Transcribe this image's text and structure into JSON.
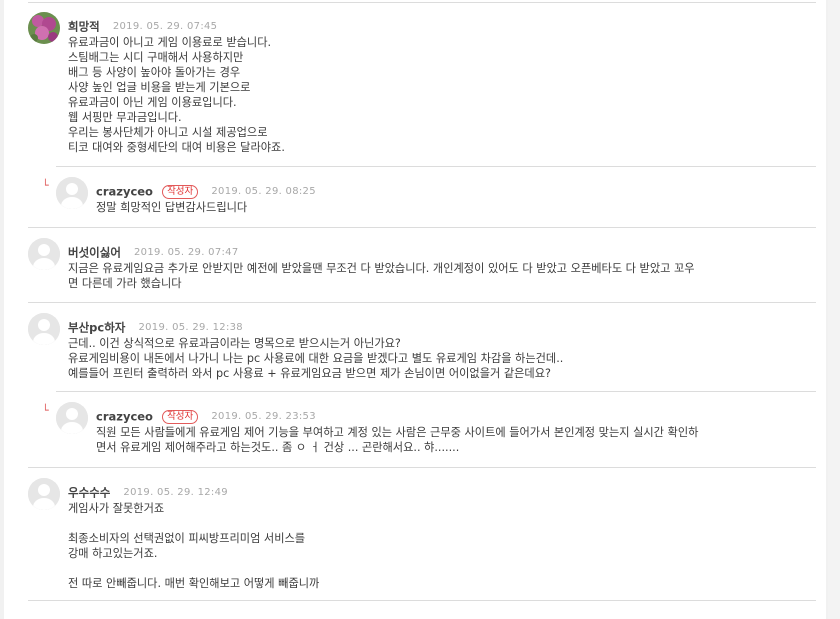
{
  "comments": [
    {
      "author": "희망적",
      "date": "2019. 05. 29.  07:45",
      "lines": [
        "유료과금이 아니고 게임 이용료로 받습니다.",
        "스팀배그는 시디 구매해서 사용하지만",
        "배그 등 사양이 높아야 돌아가는 경우",
        "사양 높인 업글 비용을 받는게 기본으로",
        "유료과금이 아닌 게임 이용료입니다.",
        "웹 서핑만 무과금입니다.",
        "우리는 봉사단체가 아니고 시설 제공업으로",
        "티코 대여와 중형세단의 대여 비용은 달라야죠."
      ]
    },
    {
      "author": "crazyceo",
      "badge": "작성자",
      "date": "2019. 05. 29.  08:25",
      "lines": [
        "정말 희망적인 답변감사드립니다"
      ]
    },
    {
      "author": "버섯이싫어",
      "date": "2019. 05. 29.  07:47",
      "lines": [
        "지금은 유료게임요금 추가로 안받지만 예전에 받았을땐 무조건 다 받았습니다. 개인계정이 있어도 다 받았고 오픈베타도 다 받았고 꼬우",
        "면 다른데 가라 했습니다"
      ]
    },
    {
      "author": "부산pc하자",
      "date": "2019. 05. 29.  12:38",
      "lines": [
        "근데.. 이건 상식적으로 유료과금이라는 명목으로 받으시는거 아닌가요?",
        "유료게임비용이 내돈에서 나가니 나는 pc 사용료에 대한 요금을 받겠다고 별도 유료게임 차감을 하는건데..",
        "예를들어 프린터 출력하러 와서 pc 사용료 + 유료게임요금 받으면 제가 손님이면 어이없을거 같은데요?"
      ]
    },
    {
      "author": "crazyceo",
      "badge": "작성자",
      "date": "2019. 05. 29.  23:53",
      "lines": [
        "직원 모든 사람들에게 유료게임 제어 기능을 부여하고 계정 있는 사람은 근무중 사이트에 들어가서 본인계정 맞는지 실시간 확인하",
        "면서 유료게임 제어해주라고 하는것도.. 좀 ㅇ ㅓ 건상 ... 곤란해서요.. 햐......."
      ]
    },
    {
      "author": "우수수수",
      "date": "2019. 05. 29.  12:49",
      "lines": [
        "게임사가 잘못한거죠",
        "",
        "최종소비자의 선택권없이 피씨방프리미엄 서비스를",
        "강매 하고있는거죠.",
        "",
        "전 따로 안빼줍니다. 매번 확인해보고 어떻게 빼줍니까"
      ]
    }
  ]
}
